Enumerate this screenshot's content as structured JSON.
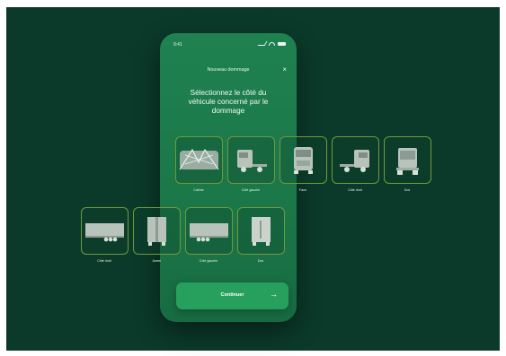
{
  "status_bar": {
    "time": "9:41"
  },
  "header": {
    "title": "Nouveau dommage",
    "close": "×"
  },
  "heading": "Sélectionnez le côté du\nvéhicule concerné par le\ndommage",
  "options_row1": [
    {
      "icon": "truck-top-view-icon",
      "label": "Cabine"
    },
    {
      "icon": "truck-left-side-icon",
      "label": "Côté gauche"
    },
    {
      "icon": "truck-front-icon",
      "label": "Face"
    },
    {
      "icon": "truck-right-side-icon",
      "label": "Côté droit"
    },
    {
      "icon": "truck-rear-icon",
      "label": "Dos"
    }
  ],
  "options_row2": [
    {
      "icon": "trailer-right-side-icon",
      "label": "Côté droit"
    },
    {
      "icon": "trailer-front-icon",
      "label": "Avant"
    },
    {
      "icon": "trailer-left-side-icon",
      "label": "Côté gauche"
    },
    {
      "icon": "trailer-rear-icon",
      "label": "Dos"
    }
  ],
  "cta": {
    "label": "Continuer",
    "arrow": "→"
  },
  "colors": {
    "background": "#0b3a2a",
    "phone": "#1f8150",
    "card_border": "#6f9a3c",
    "button": "#27a05d"
  }
}
